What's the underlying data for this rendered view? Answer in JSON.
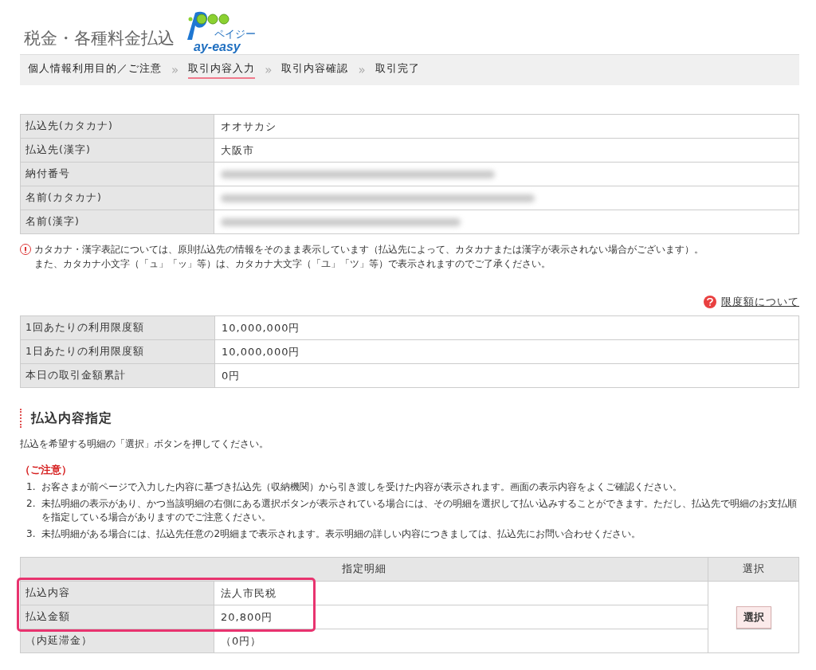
{
  "header": {
    "title": "税金・各種料金払込",
    "logo": {
      "text": "ay-easy",
      "ruby": "ペイジー"
    }
  },
  "steps": [
    {
      "label": "個人情報利用目的／ご注意",
      "selected": false
    },
    {
      "label": "取引内容入力",
      "selected": true
    },
    {
      "label": "取引内容確認",
      "selected": false
    },
    {
      "label": "取引完了",
      "selected": false
    }
  ],
  "step_separator": "»",
  "payee_table": [
    {
      "label": "払込先(カタカナ)",
      "kind": "text",
      "value": "オオサカシ"
    },
    {
      "label": "払込先(漢字)",
      "kind": "text",
      "value": "大阪市"
    },
    {
      "label": "納付番号",
      "kind": "redacted"
    },
    {
      "label": "名前(カタカナ)",
      "kind": "redacted"
    },
    {
      "label": "名前(漢字)",
      "kind": "redacted"
    }
  ],
  "notice": [
    "カタカナ・漢字表記については、原則払込先の情報をそのまま表示しています（払込先によって、カタカナまたは漢字が表示されない場合がございます）。",
    "また、カタカナ小文字（「ュ」「ッ」等）は、カタカナ大文字（「ユ」「ツ」等）で表示されますのでご了承ください。"
  ],
  "limit_link": "限度額について",
  "limit_table": [
    {
      "label": "1回あたりの利用限度額",
      "value": "10,000,000円"
    },
    {
      "label": "1日あたりの利用限度額",
      "value": "10,000,000円"
    },
    {
      "label": "本日の取引金額累計",
      "value": "0円"
    }
  ],
  "section": {
    "heading": "払込内容指定",
    "instruction": "払込を希望する明細の「選択」ボタンを押してください。",
    "caution_title": "（ご注意）",
    "cautions": [
      {
        "num": "1.",
        "text": "お客さまが前ページで入力した内容に基づき払込先（収納機関）から引き渡しを受けた内容が表示されます。画面の表示内容をよくご確認ください。"
      },
      {
        "num": "2.",
        "text": "未払明細の表示があり、かつ当該明細の右側にある選択ボタンが表示されている場合には、その明細を選択して払い込みすることができます。ただし、払込先で明細のお支払順を指定している場合がありますのでご注意ください。"
      },
      {
        "num": "3.",
        "text": "未払明細がある場合には、払込先任意の2明細まで表示されます。表示明細の詳しい内容につきましては、払込先にお問い合わせください。"
      }
    ]
  },
  "detail_table": {
    "columns": [
      "指定明細",
      "選択"
    ],
    "rows": [
      {
        "label": "払込内容",
        "value": "法人市民税",
        "highlighted": true
      },
      {
        "label": "払込金額",
        "value": "20,800円",
        "highlighted": true
      },
      {
        "label": "（内延滞金）",
        "value": "（0円）",
        "highlighted": false
      }
    ],
    "button": "選択"
  }
}
